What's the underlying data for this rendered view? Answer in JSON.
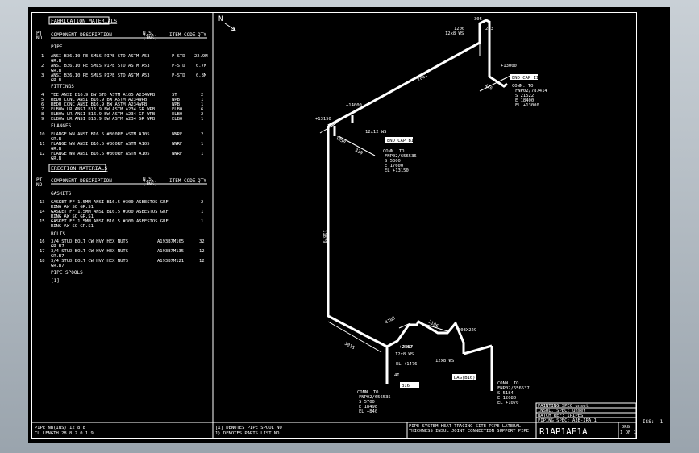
{
  "bom": {
    "fabrication_header": "FABRICATION MATERIALS",
    "col_pt": "PT",
    "col_no": "NO",
    "col_description": "COMPONENT DESCRIPTION",
    "col_ns": "N.S.",
    "col_ns_unit": "(INS)",
    "col_code": "ITEM CODE",
    "col_qty": "QTY",
    "pipe_header": "PIPE",
    "pipe_items": [
      {
        "no": "1",
        "desc": "ANSI B36.10 PE SMLS PIPE STD ASTM A53",
        "desc2": "GR.B",
        "ns": "",
        "code": "P-STD",
        "qty": "22.9M"
      },
      {
        "no": "2",
        "desc": "ANSI B36.10 PE SMLS PIPE STD ASTM A53",
        "desc2": "GR.B",
        "ns": "",
        "code": "P-STD",
        "qty": "0.7M"
      },
      {
        "no": "3",
        "desc": "ANSI B36.10 PE SMLS PIPE STD ASTM A53",
        "desc2": "GR.B",
        "ns": "",
        "code": "P-STD",
        "qty": "0.8M"
      }
    ],
    "fittings_header": "FITTINGS",
    "fitting_items": [
      {
        "no": "4",
        "desc": "TEE ANSI B16.9 BW STD ASTM A105 A234WPB",
        "code": "ST",
        "qty": "2"
      },
      {
        "no": "5",
        "desc": "REDU CONC ANSI B16.9 BW ASTM A234WPB",
        "code": "WPB",
        "qty": "1"
      },
      {
        "no": "6",
        "desc": "REDU CONC ANSI B16.9 BW ASTM A234WPB",
        "code": "WPB",
        "qty": "1"
      },
      {
        "no": "7",
        "desc": "ELBOW LR ANSI B16.9 BW ASTM A234 GR WPB",
        "code": "ELBO",
        "qty": "6"
      },
      {
        "no": "8",
        "desc": "ELBOW LR ANSI B16.9 BW ASTM A234 GR WPB",
        "code": "ELBO",
        "qty": "2"
      },
      {
        "no": "9",
        "desc": "ELBOW LR ANSI B16.9 BW ASTM A234 GR WPB",
        "code": "ELBO",
        "qty": "1"
      }
    ],
    "flanges_header": "FLANGES",
    "flange_items": [
      {
        "no": "10",
        "desc": "FLANGE WN ANSI B16.5 #300RF ASTM A105",
        "desc2": "GR.B",
        "code": "WNRF",
        "qty": "2"
      },
      {
        "no": "11",
        "desc": "FLANGE WN ANSI B16.5 #300RF ASTM A105",
        "desc2": "GR.B",
        "code": "WNRF",
        "qty": "1"
      },
      {
        "no": "12",
        "desc": "FLANGE WN ANSI B16.5 #300RF ASTM A105",
        "desc2": "GR.B",
        "code": "WNRF",
        "qty": "1"
      }
    ],
    "erection_header": "ERECTION MATERIALS",
    "gaskets_header": "GASKETS",
    "gasket_items": [
      {
        "no": "13",
        "desc": "GASKET FF 1.5MM ANSI B16.5 #300 ASBESTOS GRF",
        "desc2": "RING AW SO GR.S1",
        "qty": "2"
      },
      {
        "no": "14",
        "desc": "GASKET FF 1.5MM ANSI B16.5 #300 ASBESTOS GRF",
        "desc2": "RING AW SO GR.S1",
        "qty": "1"
      },
      {
        "no": "15",
        "desc": "GASKET FF 1.5MM ANSI B16.5 #300 ASBESTOS GRF",
        "desc2": "RING AW SO GR.S1",
        "qty": "1"
      }
    ],
    "bolts_header": "BOLTS",
    "bolt_items": [
      {
        "no": "16",
        "desc": "3/4 STUD BOLT CW HVY HEX NUTS",
        "code": "A193B7M165",
        "desc2": "GR.B7",
        "qty": "32"
      },
      {
        "no": "17",
        "desc": "3/4 STUD BOLT CW HVY HEX NUTS",
        "code": "A193B7M135",
        "desc2": "GR.B7",
        "qty": "12"
      },
      {
        "no": "18",
        "desc": "3/4 STUD BOLT CW HVY HEX NUTS",
        "code": "A193B7M121",
        "desc2": "GR.B7",
        "qty": "12"
      }
    ],
    "spools_header": "PIPE SPOOLS",
    "spool_item": "[1]"
  },
  "footer": {
    "pipe_nb": "PIPE NB(INS)  12    8    8",
    "cl_length": "CL LENGTH  28.8  2.0  1.9",
    "legend1": "[1] DENOTES PIPE SPOOL NO",
    "legend2": "1) DENOTES PARTS LIST NO",
    "hdr_row1": "PIPE SYSTEM HEAT TRACING SITE PIPE LATERAL",
    "hdr_row2": "THICKNESS INSUL JOINT CONNECTION SUPPORT PIPE",
    "painting": "PAINTING SPEC unset",
    "insul": "INSUL. SPEC: unset",
    "batch": "BATCH REF: IPIPES",
    "piping": "PIPING SPEC: A3B-IRA 1",
    "drawing_id": "R1AP1AE1A",
    "drg_label": "DRG",
    "drg_no": "1 OF 1",
    "iss": "ISS: -1"
  },
  "iso": {
    "north": "N",
    "dims": {
      "d7062": "7062",
      "d11879": "11879",
      "d3015": "3015",
      "d4103": "4103",
      "d2106": "2106",
      "d305": "305",
      "d203": "203",
      "d476": "476",
      "d1200": "1200",
      "d339": "339",
      "d1058": "1058",
      "d203x229": "203X229",
      "d2087": "2087"
    },
    "elevs": {
      "e1": "+14000",
      "e2": "+13150",
      "e3": "+13000",
      "e4": "+2167",
      "e5": "EL +1476"
    },
    "reducers": {
      "r1": "12x8 WS",
      "r2": "12x12 WS",
      "r3": "12x8 WS",
      "r4": "12x8 WS"
    },
    "tags": {
      "t1": "END CAP E17",
      "t2": "4I",
      "t3": "END CAP B16",
      "t4": "DAG(B16)",
      "t5": "B16"
    },
    "conn_a": [
      "CONN. TO",
      "FNP02/787414",
      "S 21522",
      "E 18400",
      "EL +13000"
    ],
    "conn_b": [
      "CONN. TO",
      "FNP02/656536",
      "S 5300",
      "E 17600",
      "EL +13150"
    ],
    "conn_c": [
      "CONN. TO",
      "FNP02/656535",
      "S 5700",
      "E 18498",
      "EL +840"
    ],
    "conn_d": [
      "CONN. TO",
      "FNP02/656537",
      "S 5184",
      "E 12080",
      "EL +1070"
    ],
    "n_c": "CONN. TO",
    "labels": {
      "a": "2",
      "b": "1",
      "c": "2",
      "d": "13",
      "e": "3"
    }
  }
}
